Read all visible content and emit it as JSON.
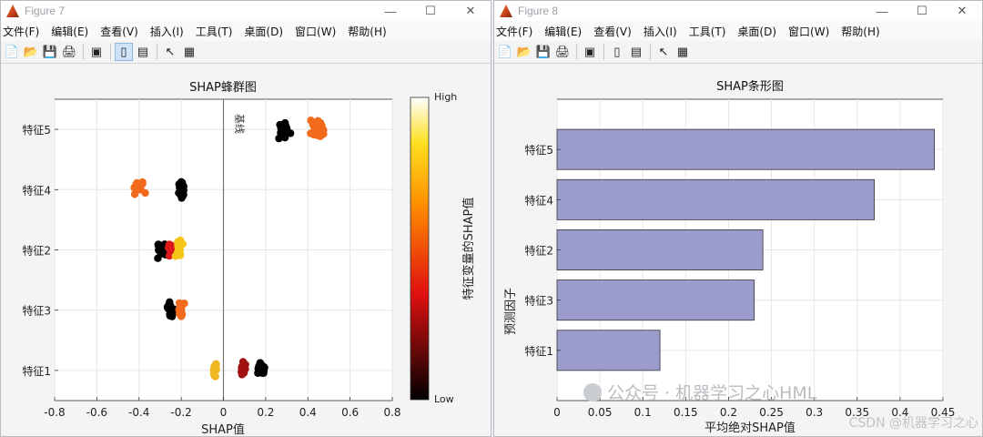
{
  "window7": {
    "title": "Figure 7",
    "menu": [
      "文件(F)",
      "编辑(E)",
      "查看(V)",
      "插入(I)",
      "工具(T)",
      "桌面(D)",
      "窗口(W)",
      "帮助(H)"
    ]
  },
  "window8": {
    "title": "Figure 8",
    "menu": [
      "文件(F)",
      "编辑(E)",
      "查看(V)",
      "插入(I)",
      "工具(T)",
      "桌面(D)",
      "窗口(W)",
      "帮助(H)"
    ]
  },
  "toolbar_icons": [
    "new-file-icon",
    "open-folder-icon",
    "save-icon",
    "print-icon",
    "print-figure-icon",
    "dock-icon",
    "property-editor-icon",
    "pointer-icon",
    "plot-browser-icon"
  ],
  "window_controls": {
    "minimize": "—",
    "maximize": "☐",
    "close": "✕"
  },
  "watermark": {
    "wechat": "公众号 · 机器学习之心HML",
    "csdn": "CSDN @机器学习之心"
  },
  "chart_data": [
    {
      "type": "scatter",
      "title": "SHAP蜂群图",
      "xlabel": "SHAP值",
      "ylabel": "",
      "xlim": [
        -0.8,
        0.8
      ],
      "xticks": [
        -0.8,
        -0.6,
        -0.4,
        -0.2,
        0,
        0.2,
        0.4,
        0.6,
        0.8
      ],
      "categories": [
        "特征1",
        "特征3",
        "特征2",
        "特征4",
        "特征5"
      ],
      "baseline": {
        "x": 0,
        "label": "基线"
      },
      "colorbar": {
        "label": "特征变量的SHAP值",
        "high": "High",
        "low": "Low",
        "colormap": "hot"
      },
      "grid": true,
      "clusters": [
        {
          "feature": "特征5",
          "center": 0.29,
          "spread": 0.035,
          "count": 22,
          "color": "#000000"
        },
        {
          "feature": "特征5",
          "center": 0.45,
          "spread": 0.045,
          "count": 26,
          "color": "#f26a1b"
        },
        {
          "feature": "特征4",
          "center": -0.4,
          "spread": 0.035,
          "count": 16,
          "color": "#f26a1b"
        },
        {
          "feature": "特征4",
          "center": -0.2,
          "spread": 0.02,
          "count": 20,
          "color": "#000000"
        },
        {
          "feature": "特征2",
          "center": -0.29,
          "spread": 0.025,
          "count": 14,
          "color": "#000000"
        },
        {
          "feature": "特征2",
          "center": -0.25,
          "spread": 0.02,
          "count": 14,
          "color": "#dd1a1a"
        },
        {
          "feature": "特征2",
          "center": -0.21,
          "spread": 0.02,
          "count": 14,
          "color": "#f5c518"
        },
        {
          "feature": "特征3",
          "center": -0.25,
          "spread": 0.02,
          "count": 18,
          "color": "#000000"
        },
        {
          "feature": "特征3",
          "center": -0.2,
          "spread": 0.015,
          "count": 12,
          "color": "#f26a1b"
        },
        {
          "feature": "特征1",
          "center": -0.04,
          "spread": 0.01,
          "count": 14,
          "color": "#f0b820"
        },
        {
          "feature": "特征1",
          "center": 0.09,
          "spread": 0.02,
          "count": 10,
          "color": "#a01010"
        },
        {
          "feature": "特征1",
          "center": 0.18,
          "spread": 0.025,
          "count": 18,
          "color": "#000000"
        }
      ]
    },
    {
      "type": "bar",
      "orientation": "horizontal",
      "title": "SHAP条形图",
      "xlabel": "平均绝对SHAP值",
      "ylabel": "预测因子",
      "categories": [
        "特征5",
        "特征4",
        "特征2",
        "特征3",
        "特征1"
      ],
      "values": [
        0.44,
        0.37,
        0.24,
        0.23,
        0.12
      ],
      "xlim": [
        0,
        0.45
      ],
      "xticks": [
        0,
        0.05,
        0.1,
        0.15,
        0.2,
        0.25,
        0.3,
        0.35,
        0.4,
        0.45
      ],
      "bar_color": "#9b9ccc",
      "grid": true
    }
  ]
}
